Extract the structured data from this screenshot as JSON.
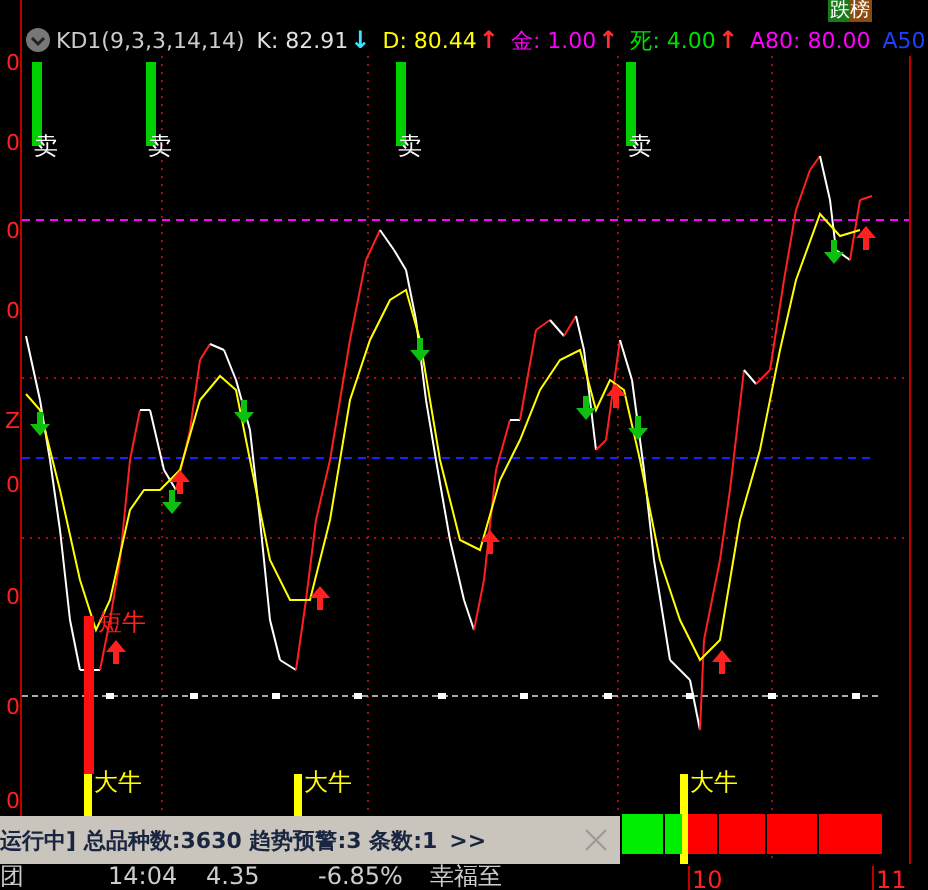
{
  "top_tab": {
    "label": "跌榜"
  },
  "left_axis": {
    "labels": [
      "0",
      "0",
      "0",
      "0",
      "Z",
      "0",
      "0",
      "0",
      "0"
    ]
  },
  "indicator": {
    "name": "KD1(9,3,3,14,14)",
    "values": [
      {
        "label": "K: 82.91",
        "color": "#e0e0e0",
        "arrow": {
          "glyph": "↓",
          "color": "#40e0ff"
        }
      },
      {
        "label": "D: 80.44",
        "color": "#ffff00",
        "arrow": {
          "glyph": "↑",
          "color": "#ff3030"
        }
      },
      {
        "label": "金: 1.00",
        "color": "#ff00ff",
        "arrow": {
          "glyph": "↑",
          "color": "#ff3030"
        }
      },
      {
        "label": "死: 4.00",
        "color": "#00e000",
        "arrow": {
          "glyph": "↑",
          "color": "#ff3030"
        }
      },
      {
        "label": "A80: 80.00",
        "color": "#ff00ff"
      },
      {
        "label": "A50",
        "color": "#2040ff"
      }
    ]
  },
  "signals": [
    {
      "kind": "sell",
      "label": "卖"
    },
    {
      "kind": "sell",
      "label": "卖"
    },
    {
      "kind": "sell",
      "label": "卖"
    },
    {
      "kind": "sell",
      "label": "卖"
    },
    {
      "kind": "short_bull",
      "label": "短牛"
    },
    {
      "kind": "big_bull",
      "label": "大牛"
    },
    {
      "kind": "big_bull",
      "label": "大牛"
    },
    {
      "kind": "big_bull",
      "label": "大牛"
    }
  ],
  "status_bar": {
    "text": "运行中] 总品种数:3630 趋势预警:3 条数:1",
    "more": ">>"
  },
  "quote_row": [
    "团",
    "14:04",
    "4.35",
    "-6.85%",
    "幸福至"
  ],
  "date_axis": [
    "10",
    "11"
  ]
}
